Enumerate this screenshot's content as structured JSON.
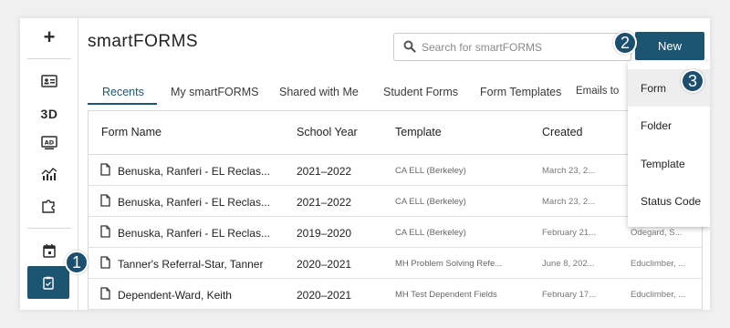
{
  "app": {
    "title": "smartFORMS"
  },
  "sidebar": {
    "items": [
      {
        "name": "add",
        "icon": "plus-icon",
        "label": "+"
      },
      {
        "name": "id-card",
        "icon": "id-card-icon"
      },
      {
        "name": "3d",
        "label": "3D"
      },
      {
        "name": "ad",
        "icon": "ad-icon"
      },
      {
        "name": "analytics",
        "icon": "chart-icon"
      },
      {
        "name": "puzzle",
        "icon": "puzzle-icon"
      },
      {
        "name": "calendar",
        "icon": "calendar-icon"
      },
      {
        "name": "forms",
        "icon": "clipboard-icon",
        "active": true
      }
    ]
  },
  "search": {
    "placeholder": "Search for smartFORMS"
  },
  "toolbar": {
    "new_label": "New"
  },
  "tabs": [
    {
      "label": "Recents",
      "active": true
    },
    {
      "label": "My smartFORMS"
    },
    {
      "label": "Shared with Me"
    },
    {
      "label": "Student Forms"
    },
    {
      "label": "Form Templates"
    },
    {
      "label": "Emails to"
    }
  ],
  "table": {
    "headers": [
      "Form Name",
      "School Year",
      "Template",
      "Created"
    ],
    "rows": [
      {
        "name": "Benuska, Ranferi - EL Reclas...",
        "year": "2021–2022",
        "template": "CA ELL (Berkeley)",
        "created": "March 23, 2...",
        "owner": ""
      },
      {
        "name": "Benuska, Ranferi - EL Reclas...",
        "year": "2021–2022",
        "template": "CA ELL (Berkeley)",
        "created": "March 23, 2...",
        "owner": ""
      },
      {
        "name": "Benuska, Ranferi - EL Reclas...",
        "year": "2019–2020",
        "template": "CA ELL (Berkeley)",
        "created": "February 21...",
        "owner": "Odegard, S..."
      },
      {
        "name": "Tanner's Referral-Star, Tanner",
        "year": "2020–2021",
        "template": "MH Problem Solving Refe...",
        "created": "June 8, 202...",
        "owner": "Educlimber, ..."
      },
      {
        "name": "Dependent-Ward, Keith",
        "year": "2020–2021",
        "template": "MH Test Dependent Fields",
        "created": "February 17...",
        "owner": "Educlimber, ..."
      }
    ]
  },
  "new_menu": {
    "items": [
      "Form",
      "Folder",
      "Template",
      "Status Code"
    ]
  },
  "callouts": [
    "1",
    "2",
    "3"
  ],
  "colors": {
    "accent": "#1b5572",
    "badge": "#1b4f70"
  }
}
